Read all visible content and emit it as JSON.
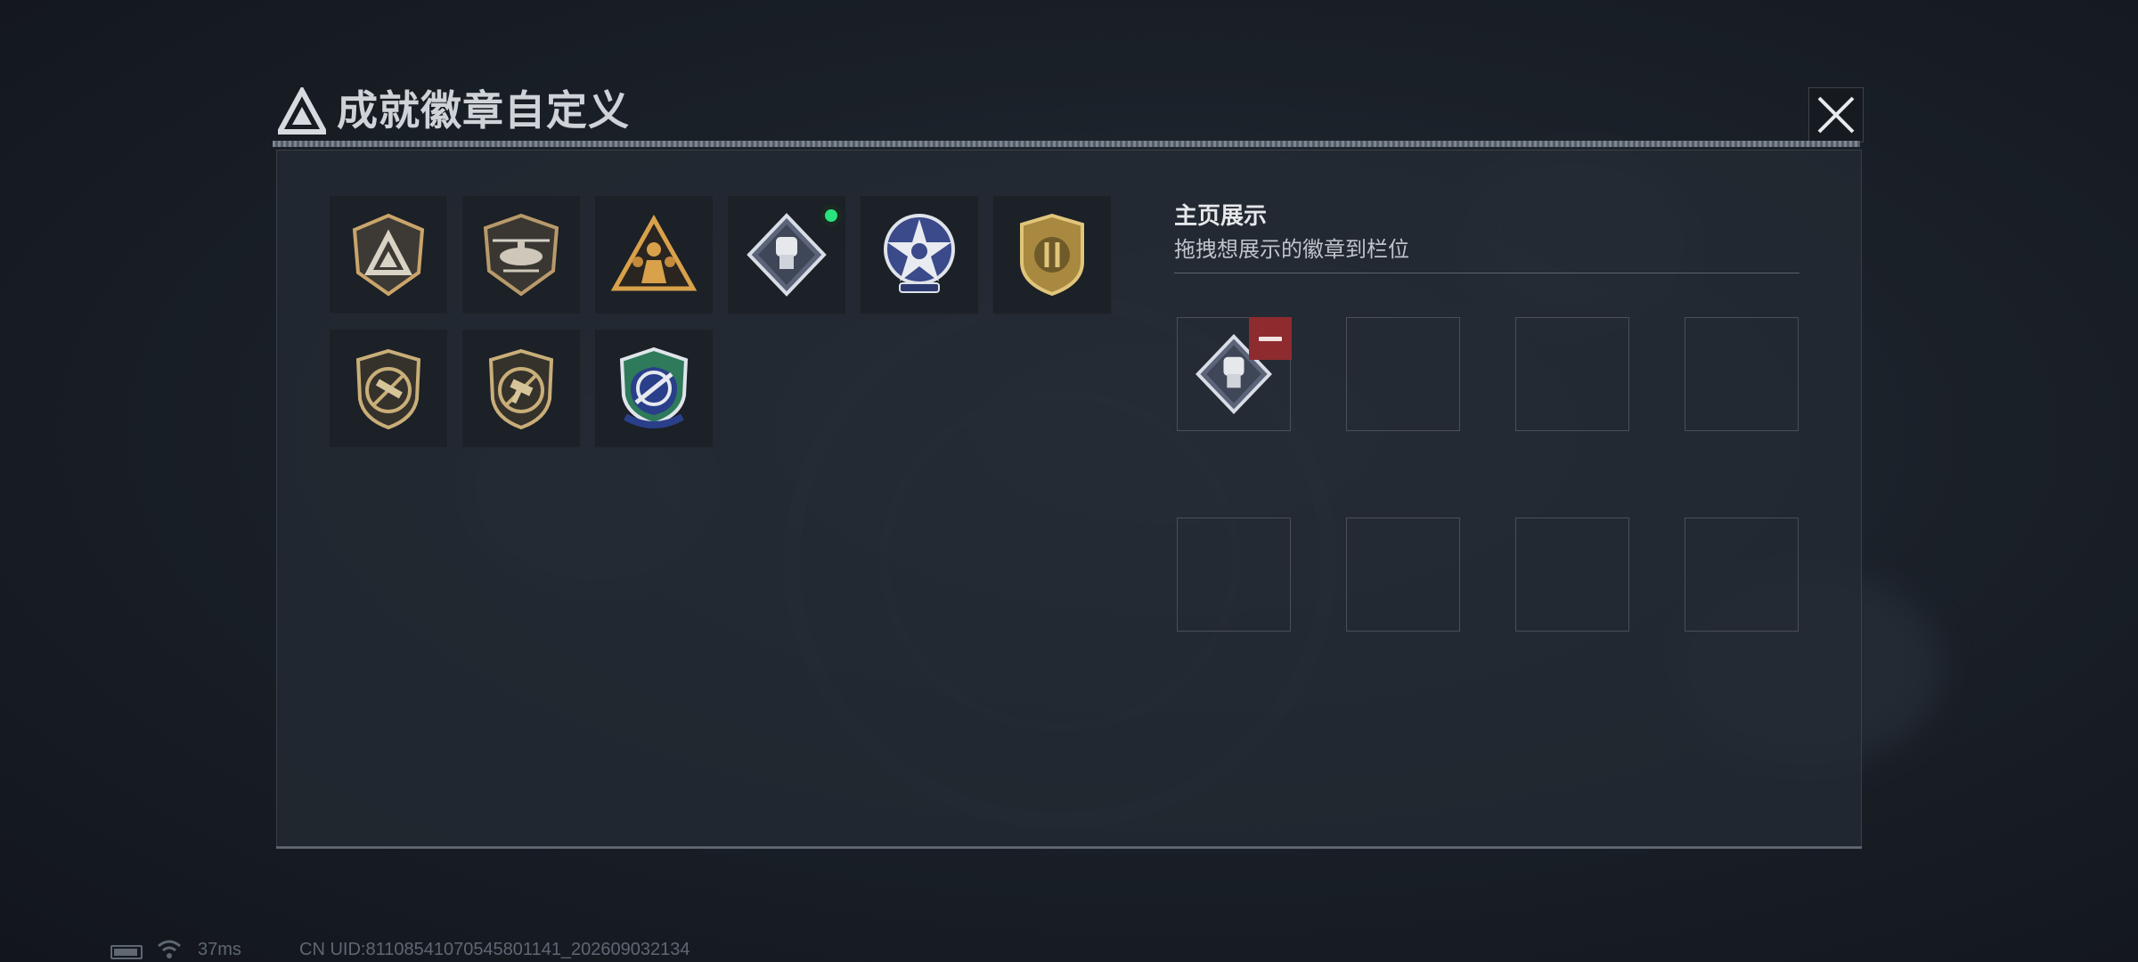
{
  "window": {
    "title": "成就徽章自定义"
  },
  "badges": [
    {
      "icon": "tri-shield-badge-icon"
    },
    {
      "icon": "helicopter-badge-icon"
    },
    {
      "icon": "soldiers-triangle-badge-icon"
    },
    {
      "icon": "fist-diamond-badge-icon",
      "new": true
    },
    {
      "icon": "star-emblem-badge-icon"
    },
    {
      "icon": "gold-crest-badge-icon"
    },
    {
      "icon": "rifle-shield-badge-icon"
    },
    {
      "icon": "smg-shield-badge-icon"
    },
    {
      "icon": "rocket-crosshair-badge-icon"
    }
  ],
  "showcase": {
    "title": "主页展示",
    "subtitle": "拖拽想展示的徽章到栏位",
    "slots": [
      {
        "filled": true,
        "icon": "fist-diamond-badge-icon"
      },
      {
        "filled": false
      },
      {
        "filled": false
      },
      {
        "filled": false
      },
      {
        "filled": false
      },
      {
        "filled": false
      },
      {
        "filled": false
      },
      {
        "filled": false
      }
    ]
  },
  "status_bar": {
    "ping": "37ms",
    "uid": "CN UID:81108541070545801141_202609032134"
  },
  "colors": {
    "accent_new": "#29e37c",
    "remove": "#8e2b2f"
  }
}
